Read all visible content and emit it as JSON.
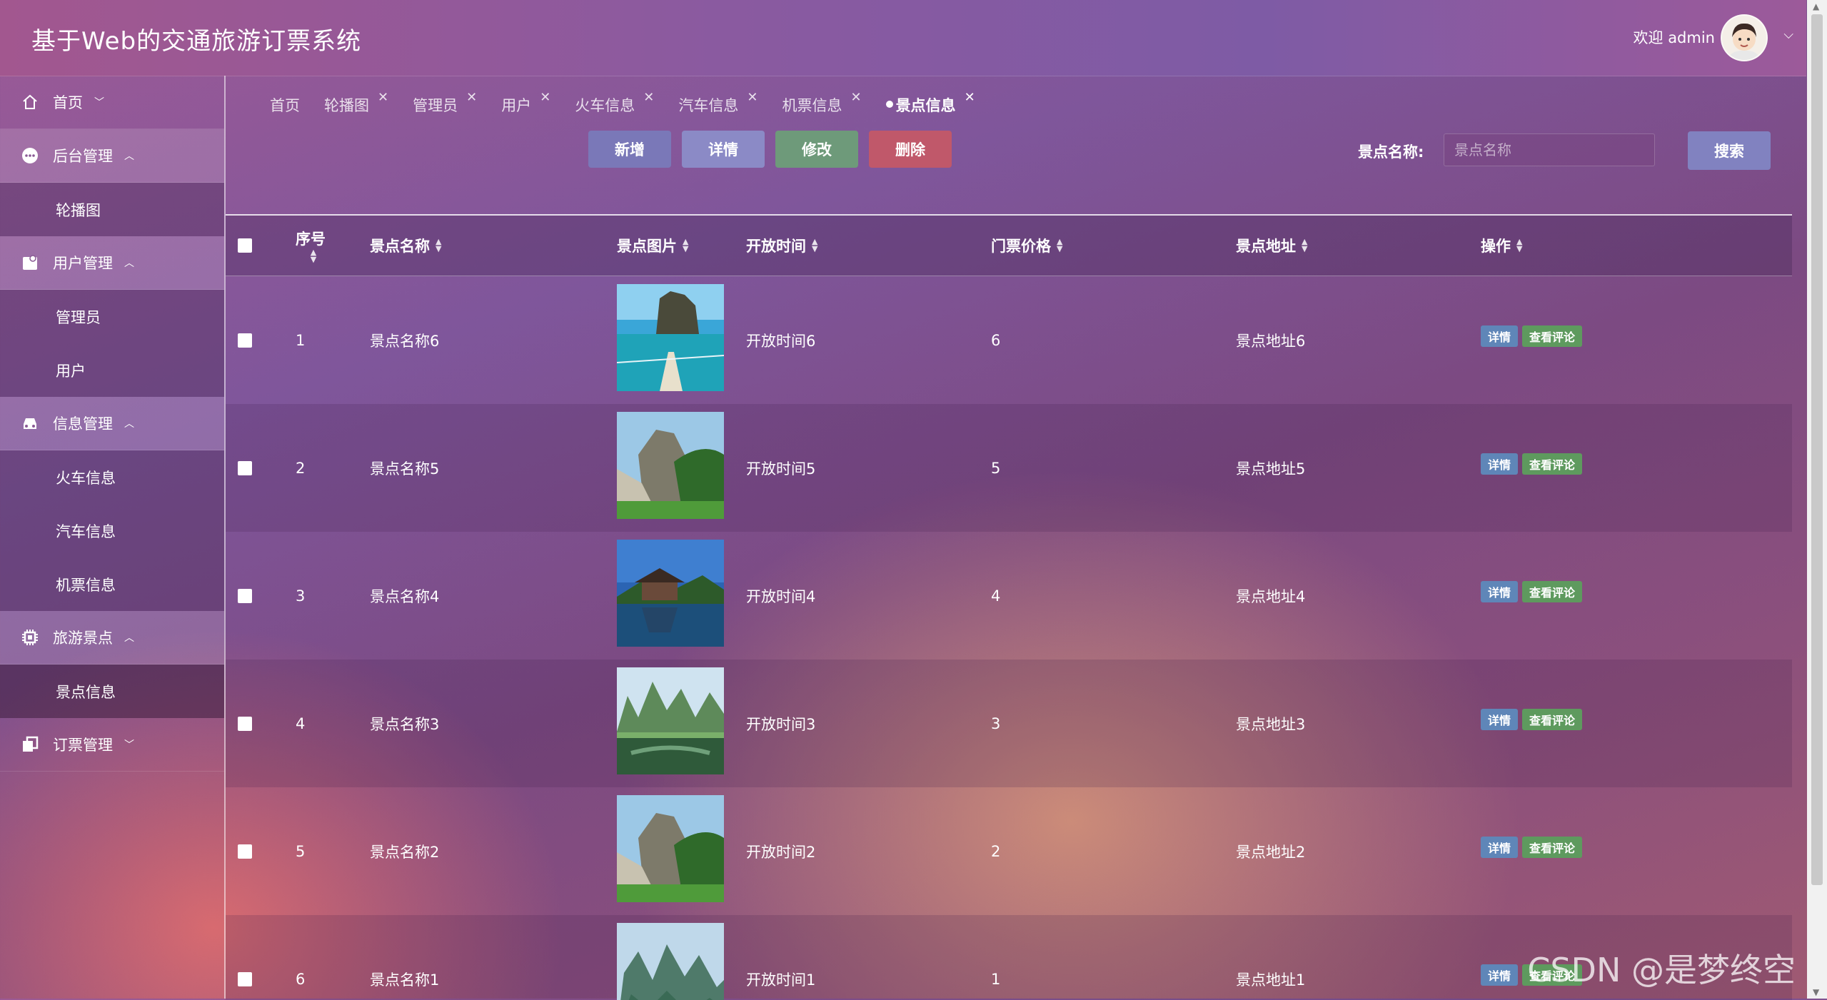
{
  "header": {
    "title": "基于Web的交通旅游订票系统",
    "welcome": "欢迎 admin"
  },
  "sidebar": {
    "menus": [
      {
        "label": "首页",
        "icon": "home-icon",
        "chevron": "down"
      },
      {
        "label": "后台管理",
        "icon": "chat-bubble-icon",
        "chevron": "up",
        "children": [
          "轮播图"
        ]
      },
      {
        "label": "用户管理",
        "icon": "user-card-icon",
        "chevron": "up",
        "children": [
          "管理员",
          "用户"
        ]
      },
      {
        "label": "信息管理",
        "icon": "car-icon",
        "chevron": "up",
        "children": [
          "火车信息",
          "汽车信息",
          "机票信息"
        ]
      },
      {
        "label": "旅游景点",
        "icon": "chip-icon",
        "chevron": "up",
        "children": [
          "景点信息"
        ]
      },
      {
        "label": "订票管理",
        "icon": "copy-icon",
        "chevron": "down"
      }
    ]
  },
  "tabs": [
    "首页",
    "轮播图",
    "管理员",
    "用户",
    "火车信息",
    "汽车信息",
    "机票信息",
    "景点信息"
  ],
  "active_tab": "景点信息",
  "toolbar": {
    "add": "新增",
    "detail": "详情",
    "edit": "修改",
    "delete": "删除"
  },
  "search": {
    "label": "景点名称:",
    "placeholder": "景点名称",
    "button": "搜索"
  },
  "table": {
    "headers": [
      "序号",
      "景点名称",
      "景点图片",
      "开放时间",
      "门票价格",
      "景点地址",
      "操作"
    ],
    "rows": [
      {
        "index": "1",
        "name": "景点名称6",
        "time": "开放时间6",
        "price": "6",
        "address": "景点地址6",
        "image": "lake-boat"
      },
      {
        "index": "2",
        "name": "景点名称5",
        "time": "开放时间5",
        "price": "5",
        "address": "景点地址5",
        "image": "rock-cliff"
      },
      {
        "index": "3",
        "name": "景点名称4",
        "time": "开放时间4",
        "price": "4",
        "address": "景点地址4",
        "image": "pagoda-lake"
      },
      {
        "index": "4",
        "name": "景点名称3",
        "time": "开放时间3",
        "price": "3",
        "address": "景点地址3",
        "image": "karst-river"
      },
      {
        "index": "5",
        "name": "景点名称2",
        "time": "开放时间2",
        "price": "2",
        "address": "景点地址2",
        "image": "rock-cliff"
      },
      {
        "index": "6",
        "name": "景点名称1",
        "time": "开放时间1",
        "price": "1",
        "address": "景点地址1",
        "image": "karst-mountains"
      }
    ],
    "op_detail": "详情",
    "op_comment": "查看评论"
  },
  "watermark": "CSDN @是梦终空"
}
